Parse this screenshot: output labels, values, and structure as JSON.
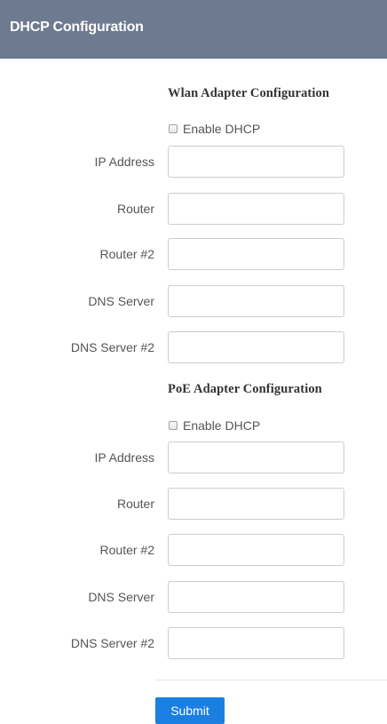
{
  "header": {
    "title": "DHCP Configuration"
  },
  "sections": [
    {
      "title": "Wlan Adapter Configuration",
      "enable_dhcp_label": "Enable DHCP",
      "enable_dhcp_checked": false,
      "fields": [
        {
          "label": "IP Address",
          "value": ""
        },
        {
          "label": "Router",
          "value": ""
        },
        {
          "label": "Router #2",
          "value": ""
        },
        {
          "label": "DNS Server",
          "value": ""
        },
        {
          "label": "DNS Server #2",
          "value": ""
        }
      ]
    },
    {
      "title": "PoE Adapter Configuration",
      "enable_dhcp_label": "Enable DHCP",
      "enable_dhcp_checked": false,
      "fields": [
        {
          "label": "IP Address",
          "value": ""
        },
        {
          "label": "Router",
          "value": ""
        },
        {
          "label": "Router #2",
          "value": ""
        },
        {
          "label": "DNS Server",
          "value": ""
        },
        {
          "label": "DNS Server #2",
          "value": ""
        }
      ]
    }
  ],
  "submit": {
    "label": "Submit"
  },
  "colors": {
    "header_bg": "#6d7a8f",
    "submit_bg": "#1a7fe0"
  }
}
